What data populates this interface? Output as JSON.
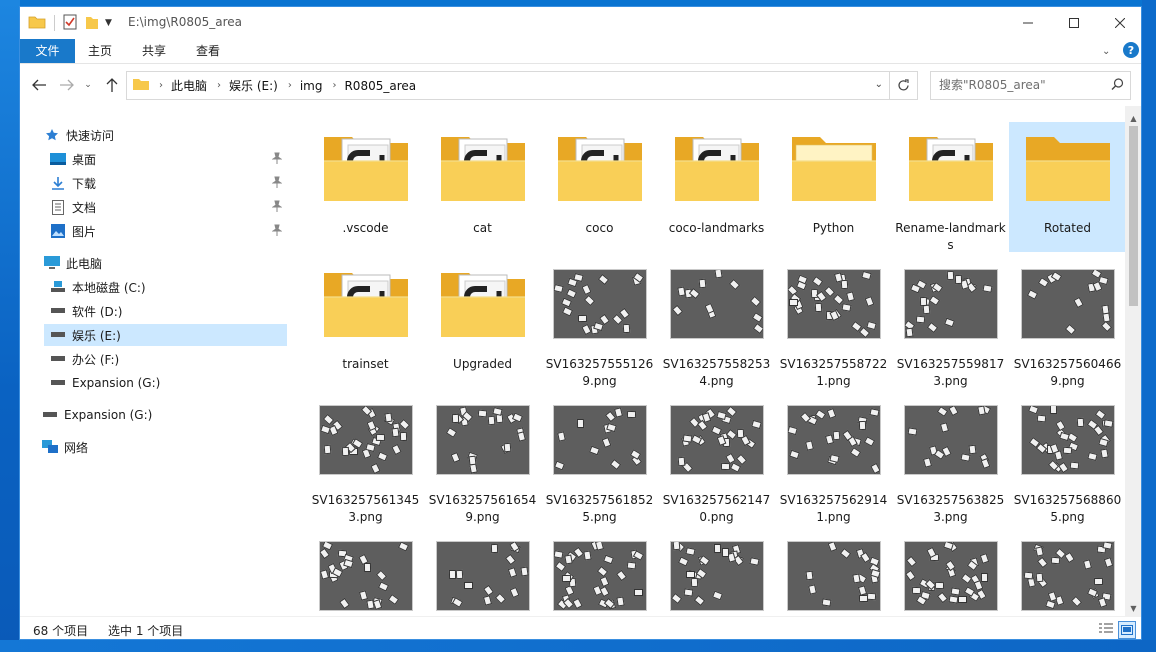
{
  "window": {
    "path_title": "E:\\img\\R0805_area"
  },
  "ribbon": {
    "tabs": [
      "文件",
      "主页",
      "共享",
      "查看"
    ]
  },
  "address": {
    "crumbs": [
      "此电脑",
      "娱乐 (E:)",
      "img",
      "R0805_area"
    ],
    "search_placeholder": "搜索\"R0805_area\""
  },
  "nav": {
    "quick_access": "快速访问",
    "quick_items": [
      "桌面",
      "下载",
      "文档",
      "图片"
    ],
    "this_pc": "此电脑",
    "drives": [
      "本地磁盘 (C:)",
      "软件 (D:)",
      "娱乐 (E:)",
      "办公 (F:)",
      "Expansion (G:)"
    ],
    "expansion": "Expansion (G:)",
    "network": "网络"
  },
  "files": [
    {
      "name": ".vscode",
      "kind": "folder-doc"
    },
    {
      "name": "cat",
      "kind": "folder-doc"
    },
    {
      "name": "coco",
      "kind": "folder-doc"
    },
    {
      "name": "coco-landmarks",
      "kind": "folder-doc"
    },
    {
      "name": "Python",
      "kind": "folder-plain"
    },
    {
      "name": "Rename-landmarks",
      "kind": "folder-doc"
    },
    {
      "name": "Rotated",
      "kind": "folder-empty",
      "selected": true
    },
    {
      "name": "trainset",
      "kind": "folder-doc"
    },
    {
      "name": "Upgraded",
      "kind": "folder-doc"
    },
    {
      "name": "SV1632575551269.png",
      "kind": "image"
    },
    {
      "name": "SV1632575582534.png",
      "kind": "image"
    },
    {
      "name": "SV1632575587221.png",
      "kind": "image"
    },
    {
      "name": "SV1632575598173.png",
      "kind": "image"
    },
    {
      "name": "SV1632575604669.png",
      "kind": "image"
    },
    {
      "name": "SV1632575613453.png",
      "kind": "image"
    },
    {
      "name": "SV1632575616549.png",
      "kind": "image"
    },
    {
      "name": "SV1632575618525.png",
      "kind": "image"
    },
    {
      "name": "SV1632575621470.png",
      "kind": "image"
    },
    {
      "name": "SV1632575629141.png",
      "kind": "image"
    },
    {
      "name": "SV1632575638253.png",
      "kind": "image"
    },
    {
      "name": "SV1632575688605.png",
      "kind": "image"
    },
    {
      "name": "",
      "kind": "image"
    },
    {
      "name": "",
      "kind": "image"
    },
    {
      "name": "",
      "kind": "image"
    },
    {
      "name": "",
      "kind": "image"
    },
    {
      "name": "",
      "kind": "image"
    },
    {
      "name": "",
      "kind": "image"
    },
    {
      "name": "",
      "kind": "image"
    }
  ],
  "status": {
    "count": "68 个项目",
    "selection": "选中 1 个项目"
  }
}
